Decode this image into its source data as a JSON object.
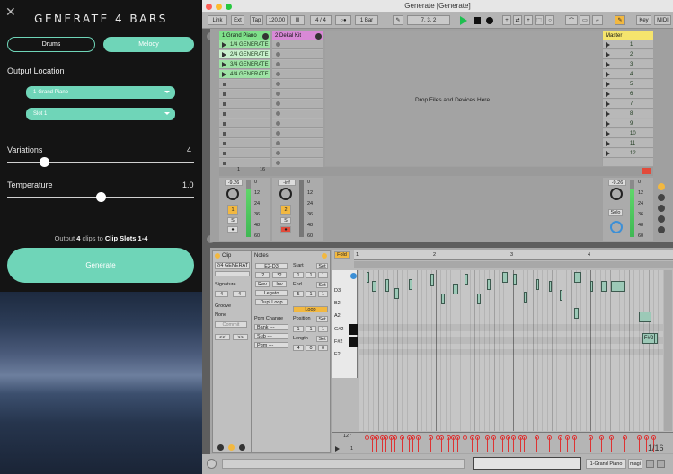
{
  "plugin": {
    "close_icon": "close-icon",
    "title": "GENERATE 4 BARS",
    "mode_tabs": [
      "Drums",
      "Melody"
    ],
    "output_location_label": "Output Location",
    "track_select": "1-Grand Piano",
    "slot_select": "Slot 1",
    "variations_label": "Variations",
    "variations_value": "4",
    "variations_fraction": 0.2,
    "temperature_label": "Temperature",
    "temperature_value": "1.0",
    "temperature_fraction": 0.5,
    "summary": {
      "pre": "Output",
      "count": "4",
      "mid": "clips to",
      "target": "Clip Slots 1-4"
    },
    "generate_button": "Generate",
    "accent": "#6fd5b8"
  },
  "ableton": {
    "window_title": "Generate  [Generate]",
    "toolbar": {
      "link": "Link",
      "ext": "Ext",
      "tap": "Tap",
      "tempo": "120.00",
      "signature": "4 / 4",
      "quantize": "1 Bar",
      "position": "7.   3.   2",
      "key": "Key",
      "midi": "MIDI"
    },
    "tracks": [
      {
        "name": "1 Grand Piano",
        "color": "#7fe08a",
        "clips": [
          "1/4 GENERATE",
          "2/4 GENERATE",
          "3/4 GENERATE",
          "4/4 GENERATE"
        ]
      },
      {
        "name": "2 Dekal Kit",
        "color": "#d889d6"
      }
    ],
    "master": {
      "name": "Master",
      "scenes": [
        "1",
        "2",
        "3",
        "4",
        "5",
        "6",
        "7",
        "8",
        "9",
        "10",
        "11",
        "12"
      ]
    },
    "drop_hint": "Drop Files and Devices Here",
    "mixer": {
      "track1": {
        "volume": "-9.26",
        "number": "1",
        "send": "16",
        "scale": [
          "0",
          "12",
          "24",
          "36",
          "48",
          "60"
        ]
      },
      "track2": {
        "volume": "-inf",
        "number": "2",
        "scale": [
          "0",
          "12",
          "24",
          "36",
          "48",
          "60"
        ]
      },
      "master": {
        "volume": "-9.26",
        "solo": "Solo",
        "scale": [
          "0",
          "12",
          "24",
          "36",
          "48",
          "60"
        ]
      }
    },
    "clip_panel": {
      "title": "Clip",
      "clip_name": "2/4 GENERAT",
      "signature_label": "Signature",
      "sig_num": "4",
      "sig_den": "4",
      "groove_label": "Groove",
      "groove": "None",
      "commit": "Commit",
      "nav": [
        "<<",
        ">>"
      ]
    },
    "notes_panel": {
      "title": "Notes",
      "range": "E2-D3",
      "buttons": [
        ":2",
        "*2",
        "Rev",
        "Inv",
        "Legato",
        "Dupl.Loop"
      ],
      "pgm_change": "Pgm Change",
      "bank": "Bank ---",
      "sub": "Sub ---",
      "pgm": "Pgm ---",
      "start_label": "Start",
      "end_label": "End",
      "set": "Set",
      "start_vals": [
        "1",
        "1",
        "1"
      ],
      "end_vals": [
        "5",
        "1",
        "1"
      ],
      "loop": "Loop",
      "position_label": "Position",
      "position_vals": [
        "1",
        "1",
        "1"
      ],
      "length_label": "Length",
      "length_vals": [
        "4",
        "0",
        "0"
      ]
    },
    "piano_roll": {
      "fold": "Fold",
      "bars": [
        "1",
        "2",
        "3",
        "4"
      ],
      "key_labels": [
        "D3",
        "B2",
        "A2",
        "G#2",
        "F#2",
        "E2"
      ],
      "hover_note": "F#2",
      "velocity_top": "127",
      "velocity_bottom": "1",
      "grid": "1/16"
    },
    "bottom": {
      "track": "1-Grand Piano",
      "device": "magi"
    }
  }
}
